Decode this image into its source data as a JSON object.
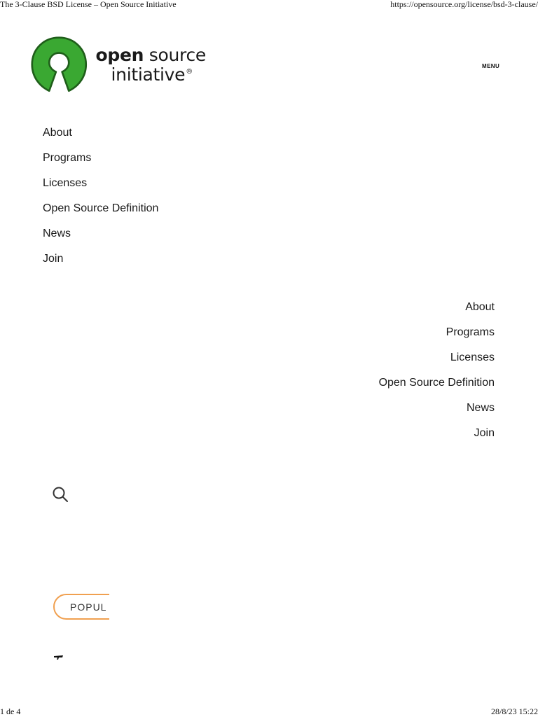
{
  "print_header": {
    "title": "The 3-Clause BSD License – Open Source Initiative",
    "url": "https://opensource.org/license/bsd-3-clause/"
  },
  "logo": {
    "word_bold": "open",
    "word_regular": " source",
    "word_line2": "initiative",
    "registered_mark": "®",
    "color": "#3aa832"
  },
  "header": {
    "menu_label": "MENU"
  },
  "nav_primary": {
    "items": [
      {
        "label": "About"
      },
      {
        "label": "Programs"
      },
      {
        "label": "Licenses"
      },
      {
        "label": "Open Source Definition"
      },
      {
        "label": "News"
      },
      {
        "label": "Join"
      }
    ]
  },
  "nav_secondary": {
    "items": [
      {
        "label": "About"
      },
      {
        "label": "Programs"
      },
      {
        "label": "Licenses"
      },
      {
        "label": "Open Source Definition"
      },
      {
        "label": "News"
      },
      {
        "label": "Join"
      }
    ]
  },
  "search": {
    "icon": "search-icon"
  },
  "popular_tag": {
    "label": "POPUL",
    "border_color": "#f0a050"
  },
  "print_footer": {
    "page": "1 de 4",
    "datetime": "28/8/23 15:22"
  }
}
